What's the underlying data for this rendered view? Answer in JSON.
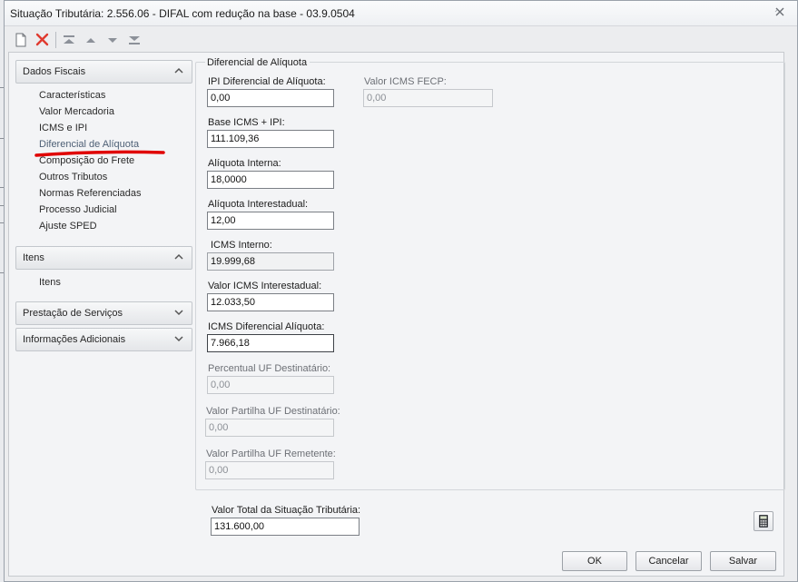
{
  "window": {
    "title": "Situação Tributária: 2.556.06 - DIFAL com redução na base - 03.9.0504"
  },
  "nav": {
    "sections": [
      {
        "label": "Dados Fiscais",
        "state": "expanded"
      },
      {
        "label": "Itens",
        "state": "expanded"
      },
      {
        "label": "Prestação de Serviços",
        "state": "collapsed"
      },
      {
        "label": "Informações Adicionais",
        "state": "collapsed"
      }
    ],
    "dados_fiscais_items": [
      "Características",
      "Valor Mercadoria",
      "ICMS e IPI",
      "Diferencial de Alíquota",
      "Composição do Frete",
      "Outros Tributos",
      "Normas Referenciadas",
      "Processo Judicial",
      "Ajuste SPED"
    ],
    "itens_items": [
      "Itens"
    ],
    "active_item": "Diferencial de Alíquota"
  },
  "form": {
    "group_title": "Diferencial de Alíquota",
    "ipi_diferencial": {
      "label": "IPI Diferencial de Alíquota:",
      "value": "0,00"
    },
    "valor_icms_fecp": {
      "label": "Valor ICMS FECP:",
      "value": "0,00"
    },
    "base_icms_ipi": {
      "label": "Base ICMS + IPI:",
      "value": "111.109,36"
    },
    "aliquota_interna": {
      "label": "Alíquota Interna:",
      "value": "18,0000"
    },
    "aliquota_interestadual": {
      "label": "Alíquota Interestadual:",
      "value": "12,00"
    },
    "icms_interno": {
      "label": "ICMS Interno:",
      "value": "19.999,68"
    },
    "valor_icms_interestadual": {
      "label": "Valor ICMS Interestadual:",
      "value": "12.033,50"
    },
    "icms_diferencial": {
      "label": "ICMS Diferencial Alíquota:",
      "value": "7.966,18"
    },
    "percentual_uf_destinatario": {
      "label": "Percentual UF Destinatário:",
      "value": "0,00"
    },
    "valor_partilha_destinatario": {
      "label": "Valor Partilha UF Destinatário:",
      "value": "0,00"
    },
    "valor_partilha_remetente": {
      "label": "Valor Partilha UF Remetente:",
      "value": "0,00"
    }
  },
  "footer": {
    "total_label": "Valor Total da Situação Tributária:",
    "total_value": "131.600,00",
    "ok_label": "OK",
    "cancel_label": "Cancelar",
    "save_label": "Salvar"
  },
  "colors": {
    "annotation_underline": "#e00000",
    "delete_icon": "#e03a2f",
    "toolbar_arrows": "#8c9199"
  },
  "icons": [
    "new-document-icon",
    "delete-icon",
    "move-first-icon",
    "move-up-icon",
    "move-down-icon",
    "move-last-icon",
    "calculator-icon",
    "close-icon",
    "chevron-up-icon",
    "chevron-down-icon"
  ]
}
